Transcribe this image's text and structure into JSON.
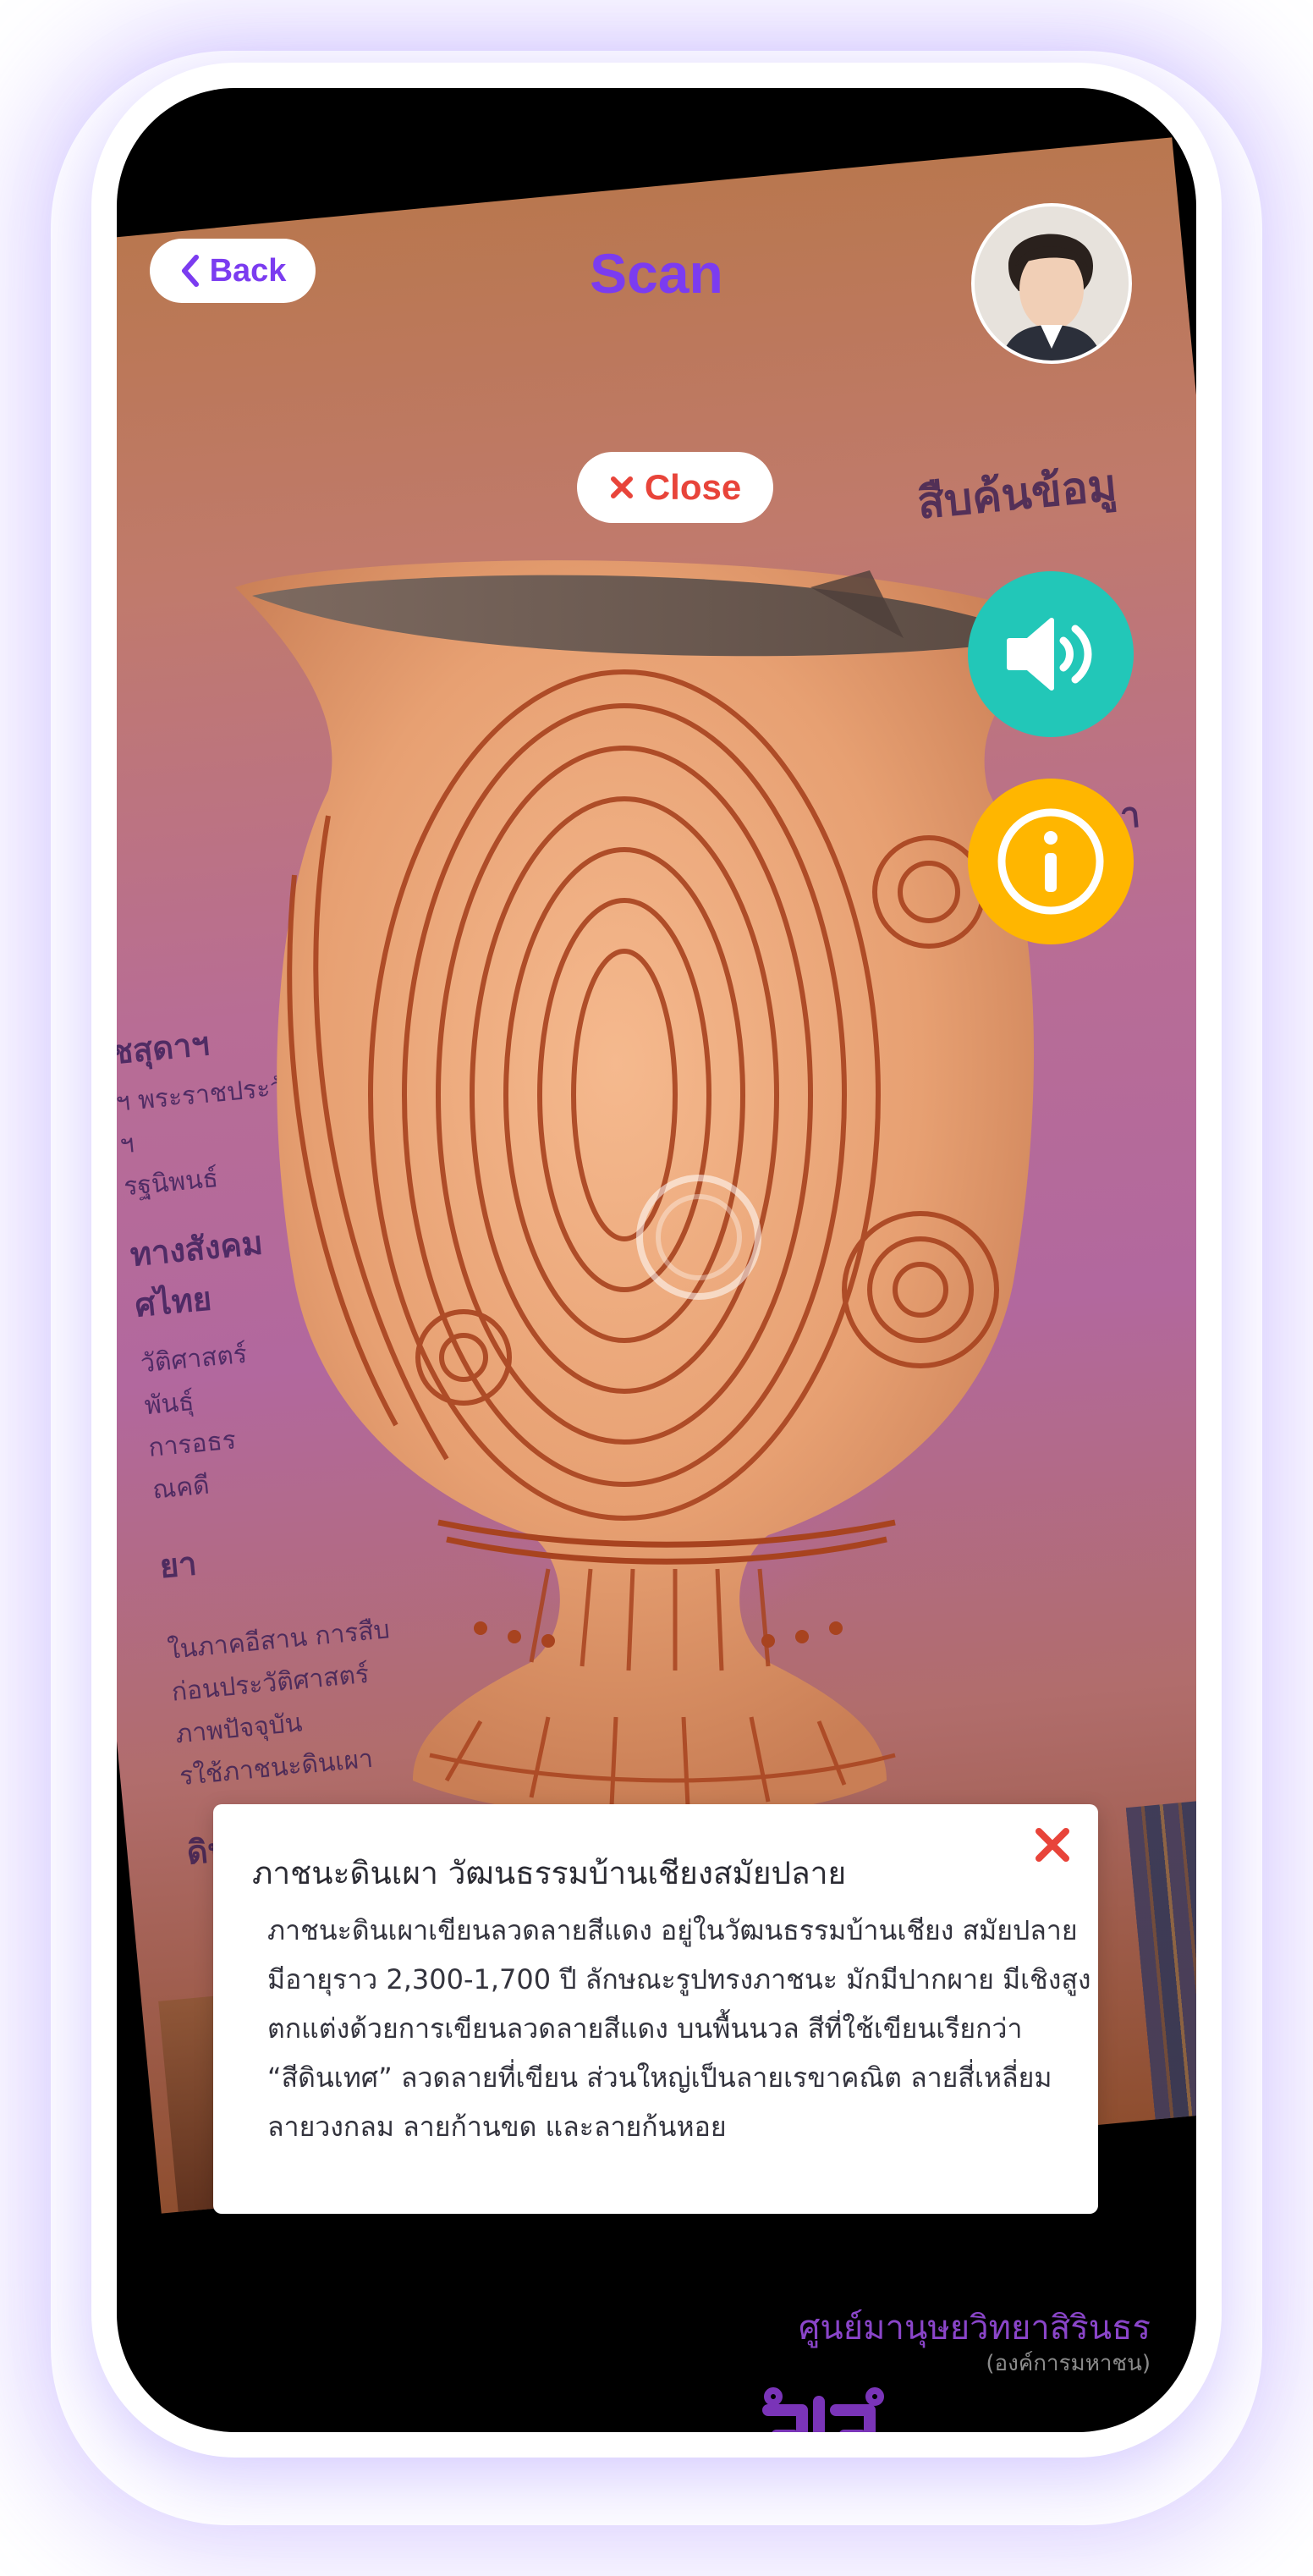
{
  "header": {
    "back_label": "Back",
    "title": "Scan"
  },
  "ar_overlay": {
    "close_label": "Close",
    "audio_icon": "speaker-volume-icon",
    "info_icon": "info-icon"
  },
  "info_card": {
    "title": "ภาชนะดินเผา วัฒนธรรมบ้านเชียงสมัยปลาย",
    "body_lines": [
      "ภาชนะดินเผาเขียนลวดลายสีแดง อยู่ในวัฒนธรรมบ้านเชียง สมัยปลาย",
      "มีอายุราว 2,300-1,700 ปี ลักษณะรูปทรงภาชนะ มักมีปากผาย มีเชิงสูง",
      "ตกแต่งด้วยการเขียนลวดลายสีแดง บนพื้นนวล สีที่ใช้เขียนเรียกว่า",
      "“สีดินเทศ” ลวดลายที่เขียน ส่วนใหญ่เป็นลายเรขาคณิต ลายสี่เหลี่ยม",
      "ลายวงกลม ลายก้านขด และลายก้นหอย"
    ]
  },
  "footer": {
    "org_name": "ศูนย์มานุษยวิทยาสิรินธร",
    "org_sub": "(องค์การมหาชน)"
  },
  "background_book_text": {
    "heading_right": "สืบค้นข้อมู",
    "heading_right_2": "นิทรรศกา",
    "left_lines": [
      "ชสุดาฯ",
      "ฯ พระราชประวัติ",
      "ฯ",
      "รฐนิพนธ์",
      "ทางสังคม",
      "ศไทย",
      "วัติศาสตร์",
      "พันธุ์",
      "การอธร",
      "ณคดี",
      "ยา",
      "ในภาคอีสาน การสืบ",
      "ก่อนประวัติศาสตร์",
      "ภาพปัจจุบัน",
      "รใช้ภาชนะดินเผา",
      "ดินเผา"
    ]
  },
  "colors": {
    "accent_purple": "#7b3cf0",
    "close_red": "#e8443a",
    "audio_teal": "#22c7b8",
    "info_yellow": "#ffb600",
    "logo_purple": "#8a45c9"
  }
}
